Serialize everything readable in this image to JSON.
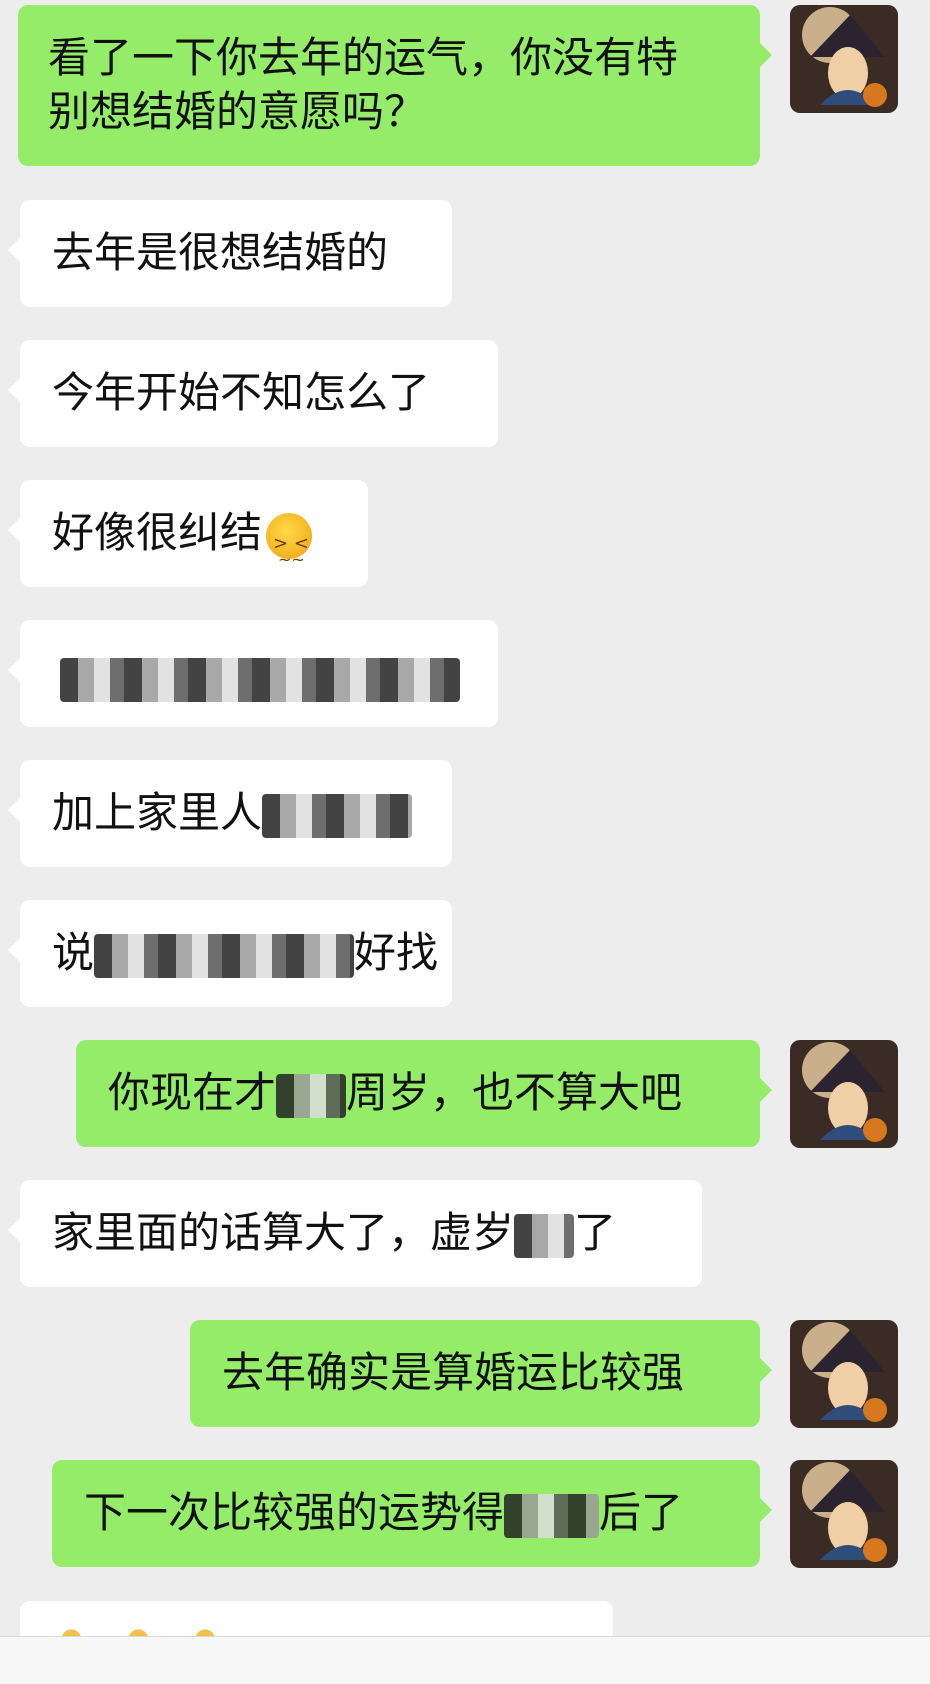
{
  "colors": {
    "background": "#ededed",
    "outgoing_bubble": "#95ec69",
    "incoming_bubble": "#ffffff"
  },
  "messages": [
    {
      "dir": "out",
      "lines": [
        "看了一下你去年的运气，你没有特",
        "别想结婚的意愿吗？"
      ]
    },
    {
      "dir": "in",
      "text": "去年是很想结婚的"
    },
    {
      "dir": "in",
      "text": "今年开始不知怎么了"
    },
    {
      "dir": "in",
      "text": "好像很纠结",
      "emoji": "confounded-face-emoji"
    },
    {
      "dir": "in",
      "text": "",
      "redacted": true
    },
    {
      "dir": "in",
      "prefix": "加上家里人",
      "suffix": ""
    },
    {
      "dir": "in",
      "prefix": "说",
      "suffix": "好找"
    },
    {
      "dir": "out",
      "prefix": "你现在才",
      "suffix": "周岁，也不算大吧"
    },
    {
      "dir": "in",
      "prefix": "家里面的话算大了，虚岁",
      "suffix": "了"
    },
    {
      "dir": "out",
      "text": "去年确实是算婚运比较强"
    },
    {
      "dir": "out",
      "prefix": "下一次比较强的运势得",
      "suffix": "后了"
    }
  ]
}
